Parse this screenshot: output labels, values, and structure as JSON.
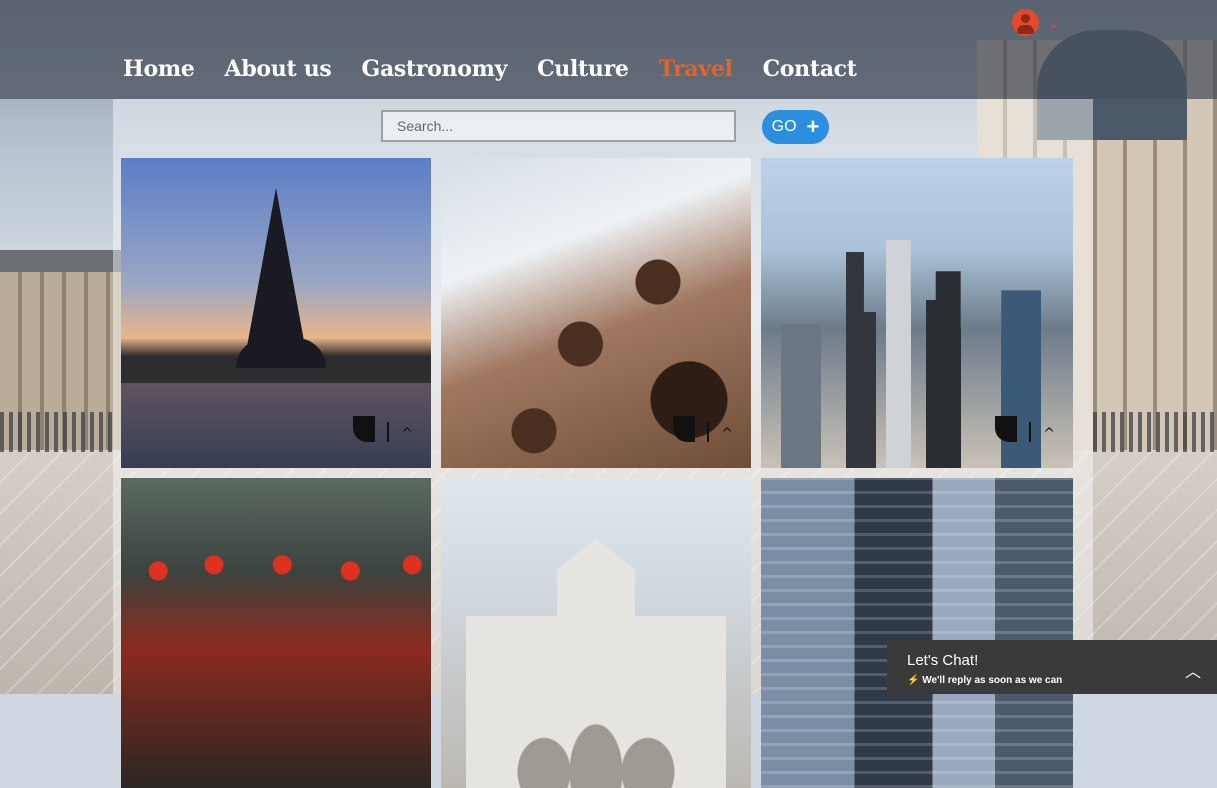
{
  "nav": {
    "items": [
      "Home",
      "About us",
      "Gastronomy",
      "Culture",
      "Travel",
      "Contact"
    ],
    "active": "Travel",
    "active_color": "#e3632e"
  },
  "user": {
    "icon": "user-avatar-icon",
    "menu_icon": "chevron-down-icon"
  },
  "search": {
    "placeholder": "Search...",
    "value": ""
  },
  "go_button": {
    "label": "GO",
    "icon": "plus-icon",
    "color": "#2b8fe0"
  },
  "gallery": {
    "tiles": [
      {
        "name": "eiffel-tower"
      },
      {
        "name": "colosseum"
      },
      {
        "name": "los-angeles-skyline"
      },
      {
        "name": "chinese-street-lanterns"
      },
      {
        "name": "puerta-de-alcala"
      },
      {
        "name": "new-york-street"
      }
    ]
  },
  "chat": {
    "title": "Let's Chat!",
    "subtitle": "We'll reply as soon as we can",
    "toggle_icon": "chevron-up-icon",
    "bolt_icon": "lightning-icon",
    "bg_color": "#3a3a3a"
  }
}
